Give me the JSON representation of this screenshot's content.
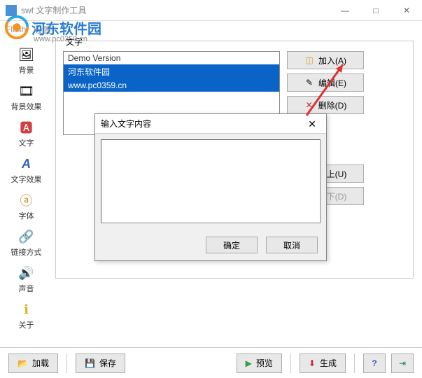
{
  "window": {
    "title": "swf 文字制作工具",
    "controls": {
      "minimize": "—",
      "maximize": "□",
      "close": "✕"
    }
  },
  "watermark": {
    "text": "河东软件园",
    "url": "www.pc0359.cn"
  },
  "menubar": {
    "flash": "Flash",
    "settings": "设置"
  },
  "sidebar": {
    "items": [
      {
        "label": "背景",
        "icon": "🖼"
      },
      {
        "label": "背景效果",
        "icon": "🎞"
      },
      {
        "label": "文字",
        "icon": "🅰"
      },
      {
        "label": "文字效果",
        "icon": "A"
      },
      {
        "label": "字体",
        "icon": "ⓐ"
      },
      {
        "label": "链接方式",
        "icon": "🔗"
      },
      {
        "label": "声音",
        "icon": "🔊"
      },
      {
        "label": "关于",
        "icon": "ℹ"
      }
    ]
  },
  "groupbox": {
    "title": "文字"
  },
  "listbox": {
    "rows": [
      {
        "text": "Demo Version",
        "selected": false,
        "demo": true
      },
      {
        "text": "河东软件园",
        "selected": true
      },
      {
        "text": "www.pc0359.cn",
        "selected": true
      }
    ]
  },
  "actions": {
    "add": "加入(A)",
    "edit": "编辑(E)",
    "delete": "删除(D)",
    "up": "向上(U)",
    "down": "向下(D)"
  },
  "dialog": {
    "title": "输入文字内容",
    "ok": "确定",
    "cancel": "取消",
    "value": ""
  },
  "bottombar": {
    "load": "加载",
    "save": "保存",
    "preview": "预览",
    "generate": "生成"
  }
}
